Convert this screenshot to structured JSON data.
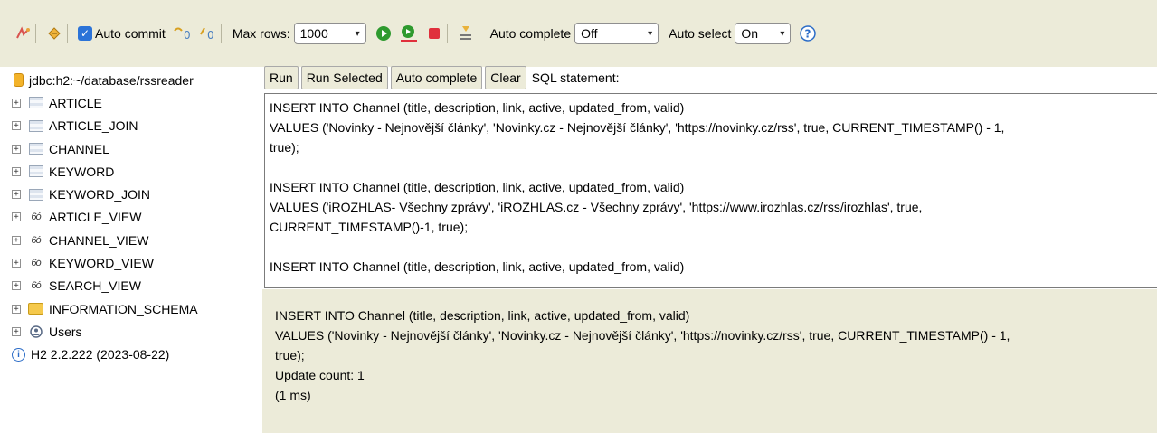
{
  "toolbar": {
    "auto_commit_label": "Auto commit",
    "max_rows_label": "Max rows:",
    "max_rows_value": "1000",
    "auto_complete_label": "Auto complete",
    "auto_complete_value": "Off",
    "auto_select_label": "Auto select",
    "auto_select_value": "On",
    "colors": {
      "background": "#ecebd9",
      "run_green": "#2e9a2e",
      "stop_red": "#e0303c",
      "help_blue": "#2b6cc7"
    }
  },
  "tree": {
    "connection": "jdbc:h2:~/database/rssreader",
    "items": [
      {
        "label": "ARTICLE",
        "kind": "table"
      },
      {
        "label": "ARTICLE_JOIN",
        "kind": "table"
      },
      {
        "label": "CHANNEL",
        "kind": "table"
      },
      {
        "label": "KEYWORD",
        "kind": "table"
      },
      {
        "label": "KEYWORD_JOIN",
        "kind": "table"
      },
      {
        "label": "ARTICLE_VIEW",
        "kind": "view"
      },
      {
        "label": "CHANNEL_VIEW",
        "kind": "view"
      },
      {
        "label": "KEYWORD_VIEW",
        "kind": "view"
      },
      {
        "label": "SEARCH_VIEW",
        "kind": "view"
      },
      {
        "label": "INFORMATION_SCHEMA",
        "kind": "folder"
      },
      {
        "label": "Users",
        "kind": "users"
      }
    ],
    "version": "H2 2.2.222 (2023-08-22)"
  },
  "buttons": {
    "run": "Run",
    "run_selected": "Run Selected",
    "auto_complete": "Auto complete",
    "clear": "Clear",
    "sql_statement_label": "SQL statement:"
  },
  "sql_lines": [
    "INSERT INTO Channel (title, description, link, active, updated_from, valid)",
    "VALUES ('Novinky - Nejnovější články', 'Novinky.cz - Nejnovější články', 'https://novinky.cz/rss', true, CURRENT_TIMESTAMP() - 1,",
    "true);",
    "",
    "INSERT INTO Channel (title, description, link, active, updated_from, valid)",
    "VALUES ('iROZHLAS- Všechny zprávy', 'iROZHLAS.cz - Všechny zprávy', 'https://www.irozhlas.cz/rss/irozhlas', true,",
    "CURRENT_TIMESTAMP()-1, true);",
    "",
    "INSERT INTO Channel (title, description, link, active, updated_from, valid)"
  ],
  "result_lines": [
    "INSERT INTO Channel (title, description, link, active, updated_from, valid)",
    "VALUES ('Novinky - Nejnovější články', 'Novinky.cz - Nejnovější články', 'https://novinky.cz/rss', true, CURRENT_TIMESTAMP() - 1,",
    "true);",
    "Update count: 1",
    "(1 ms)"
  ]
}
